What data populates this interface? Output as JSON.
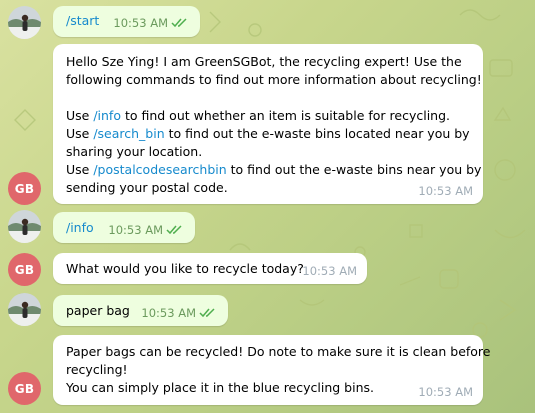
{
  "colors": {
    "background": "#c8d68c",
    "outgoing_bubble": "#eefedf",
    "incoming_bubble": "#ffffff",
    "command_link": "#168acd",
    "bot_avatar": "#e0676b"
  },
  "bot": {
    "avatar_initials": "GB"
  },
  "messages": [
    {
      "dir": "out",
      "text": "/start",
      "time": "10:53 AM",
      "status_icon": "double-check-icon"
    },
    {
      "dir": "in",
      "line1": "Hello Sze Ying! I am GreenSGBot, the recycling expert! Use the",
      "line2": "following commands to find out more information about recycling!",
      "line3_pre": "Use ",
      "line3_cmd": "/info",
      "line3_post": " to find out whether an item is suitable for recycling.",
      "line4_pre": "Use ",
      "line4_cmd": "/search_bin",
      "line4_post": " to find out the e-waste bins located near you by",
      "line5": "sharing your location.",
      "line6_pre": "Use ",
      "line6_cmd": "/postalcodesearchbin",
      "line6_post": " to find out the e-waste bins near you by",
      "line7": "sending your postal code.",
      "time": "10:53 AM"
    },
    {
      "dir": "out",
      "text": "/info",
      "time": "10:53 AM",
      "status_icon": "double-check-icon"
    },
    {
      "dir": "in",
      "text": "What would you like to recycle today?",
      "time": "10:53 AM"
    },
    {
      "dir": "out",
      "text": "paper bag",
      "time": "10:53 AM",
      "status_icon": "double-check-icon"
    },
    {
      "dir": "in",
      "line1": "Paper bags can be recycled! Do note to make sure it is clean before",
      "line2": "recycling!",
      "line3": "You can simply place it in the blue recycling bins.",
      "time": "10:53 AM"
    }
  ]
}
